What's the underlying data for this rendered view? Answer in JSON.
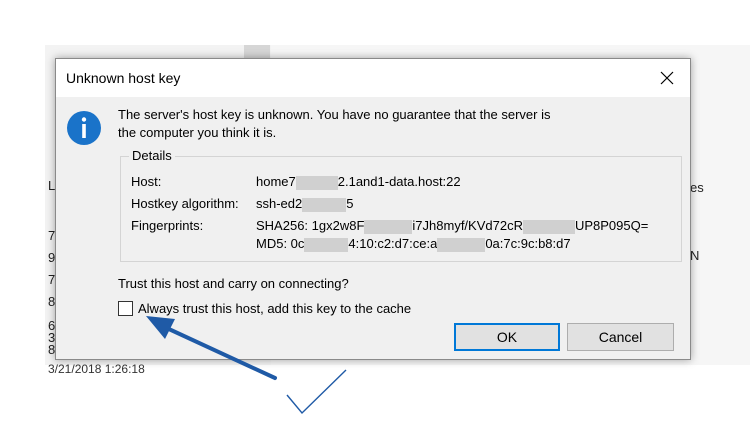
{
  "background": {
    "frag_left": [
      "L",
      "7",
      "9",
      "7",
      "8",
      "6",
      "3",
      "8"
    ],
    "frag_right": [
      "es",
      "N"
    ],
    "date_text": "3/21/2018 1:26:18"
  },
  "dialog": {
    "title": "Unknown host key",
    "message_line1": "The server's host key is unknown. You have no guarantee that the server is",
    "message_line2": "the computer you think it is.",
    "details": {
      "legend": "Details",
      "host_label": "Host:",
      "host_prefix": "home7",
      "host_suffix": "2.1and1-data.host:22",
      "algo_label": "Hostkey algorithm:",
      "algo_prefix": "ssh-ed2",
      "algo_suffix": "5",
      "fingerprint_label": "Fingerprints:",
      "sha_prefix": "SHA256: 1gx2w8F",
      "sha_mid": "i7Jh8myf/KVd72cR",
      "sha_suffix": "UP8P095Q=",
      "md5_prefix": "MD5: 0c",
      "md5_mid": "4:10:c2:d7:ce:a",
      "md5_suffix": "0a:7c:9c:b8:d7"
    },
    "question": "Trust this host and carry on connecting?",
    "checkbox_label": "Always trust this host, add this key to the cache",
    "checkbox_checked": false,
    "ok_label": "OK",
    "cancel_label": "Cancel"
  },
  "colors": {
    "info_icon": "#1a73c9",
    "ok_border": "#0078d7",
    "annotation": "#1f5aa6"
  },
  "icons": {
    "info": "info-icon",
    "close": "close-icon",
    "annotation_arrow": "arrow-icon",
    "annotation_check": "checkmark-icon"
  }
}
